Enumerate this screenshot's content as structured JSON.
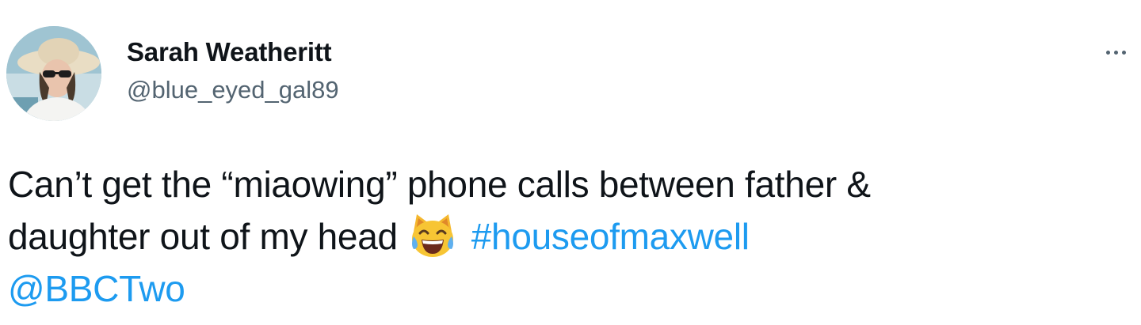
{
  "author": {
    "display_name": "Sarah Weatheritt",
    "handle": "@blue_eyed_gal89"
  },
  "tweet": {
    "line1": "Can’t get the “miaowing” phone calls between father &",
    "line2_prefix": "daughter out of my head",
    "emoji": "cat-face-with-tears-of-joy",
    "hashtag": "#houseofmaxwell",
    "mention": "@BBCTwo"
  },
  "icons": {
    "more": "more-horizontal-icon"
  },
  "colors": {
    "text": "#0f1419",
    "secondary": "#536471",
    "link": "#1d9bf0"
  }
}
